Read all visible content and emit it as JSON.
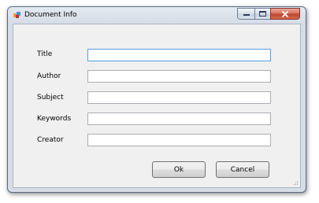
{
  "window": {
    "title": "Document Info",
    "controls": {
      "minimize": "minimize-icon",
      "maximize": "maximize-icon",
      "close": "close-icon"
    }
  },
  "form": {
    "fields": [
      {
        "label": "Title",
        "value": "",
        "focused": true
      },
      {
        "label": "Author",
        "value": ""
      },
      {
        "label": "Subject",
        "value": ""
      },
      {
        "label": "Keywords",
        "value": ""
      },
      {
        "label": "Creator",
        "value": ""
      }
    ]
  },
  "buttons": {
    "ok_label": "Ok",
    "cancel_label": "Cancel"
  },
  "colors": {
    "focus_border": "#569de5",
    "close_button": "#c0452c",
    "dialog_background": "#f0f0f0"
  }
}
